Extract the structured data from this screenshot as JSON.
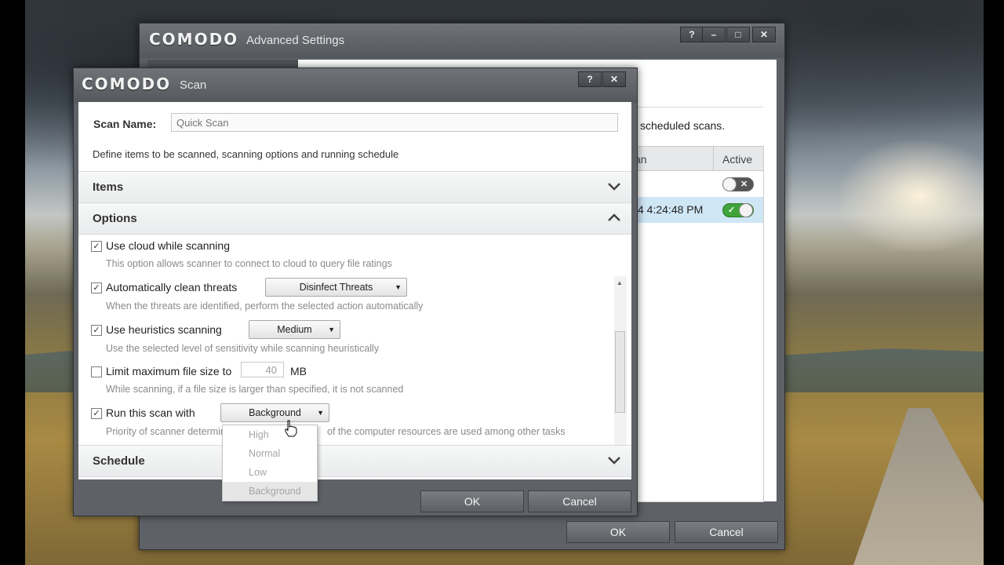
{
  "advanced_window": {
    "brand": "COMODO",
    "title": "Advanced Settings",
    "controls": [
      "?",
      "–",
      "□",
      "✕"
    ],
    "info_text": "scheduled scans.",
    "grid": {
      "col_scan_partial": "an",
      "col_active": "Active",
      "rows": [
        {
          "time": "",
          "active": false
        },
        {
          "time": "4 4:24:48 PM",
          "active": true
        }
      ]
    },
    "ok_label": "OK",
    "cancel_label": "Cancel"
  },
  "scan_dialog": {
    "brand": "COMODO",
    "title": "Scan",
    "controls": [
      "?",
      "✕"
    ],
    "scan_name_label": "Scan Name:",
    "scan_name_placeholder": "Quick Scan",
    "define_text": "Define items to be scanned, scanning options and running schedule",
    "sections": {
      "items": "Items",
      "options": "Options",
      "schedule": "Schedule"
    },
    "options": [
      {
        "label": "Use cloud while scanning",
        "checked": true,
        "desc": "This option allows scanner to connect to cloud to query file ratings"
      },
      {
        "label": "Automatically clean threats",
        "checked": true,
        "dropdown": "Disinfect Threats",
        "desc": "When the threats are identified, perform the selected action automatically"
      },
      {
        "label": "Use heuristics scanning",
        "checked": true,
        "dropdown": "Medium",
        "desc": "Use the selected level of sensitivity while scanning heuristically"
      },
      {
        "label": "Limit maximum file size to",
        "checked": false,
        "value": "40",
        "unit": "MB",
        "desc": "While scanning, if a file size is larger than specified, it is not scanned"
      },
      {
        "label": "Run this scan with",
        "checked": true,
        "dropdown": "Background",
        "desc_left": "Priority of scanner determines",
        "desc_mid": "m",
        "desc_right": "of the computer resources are used among other tasks"
      }
    ],
    "priority_menu": [
      "High",
      "Normal",
      "Low",
      "Background"
    ],
    "priority_selected": "Background",
    "ok_label": "OK",
    "cancel_label": "Cancel"
  }
}
